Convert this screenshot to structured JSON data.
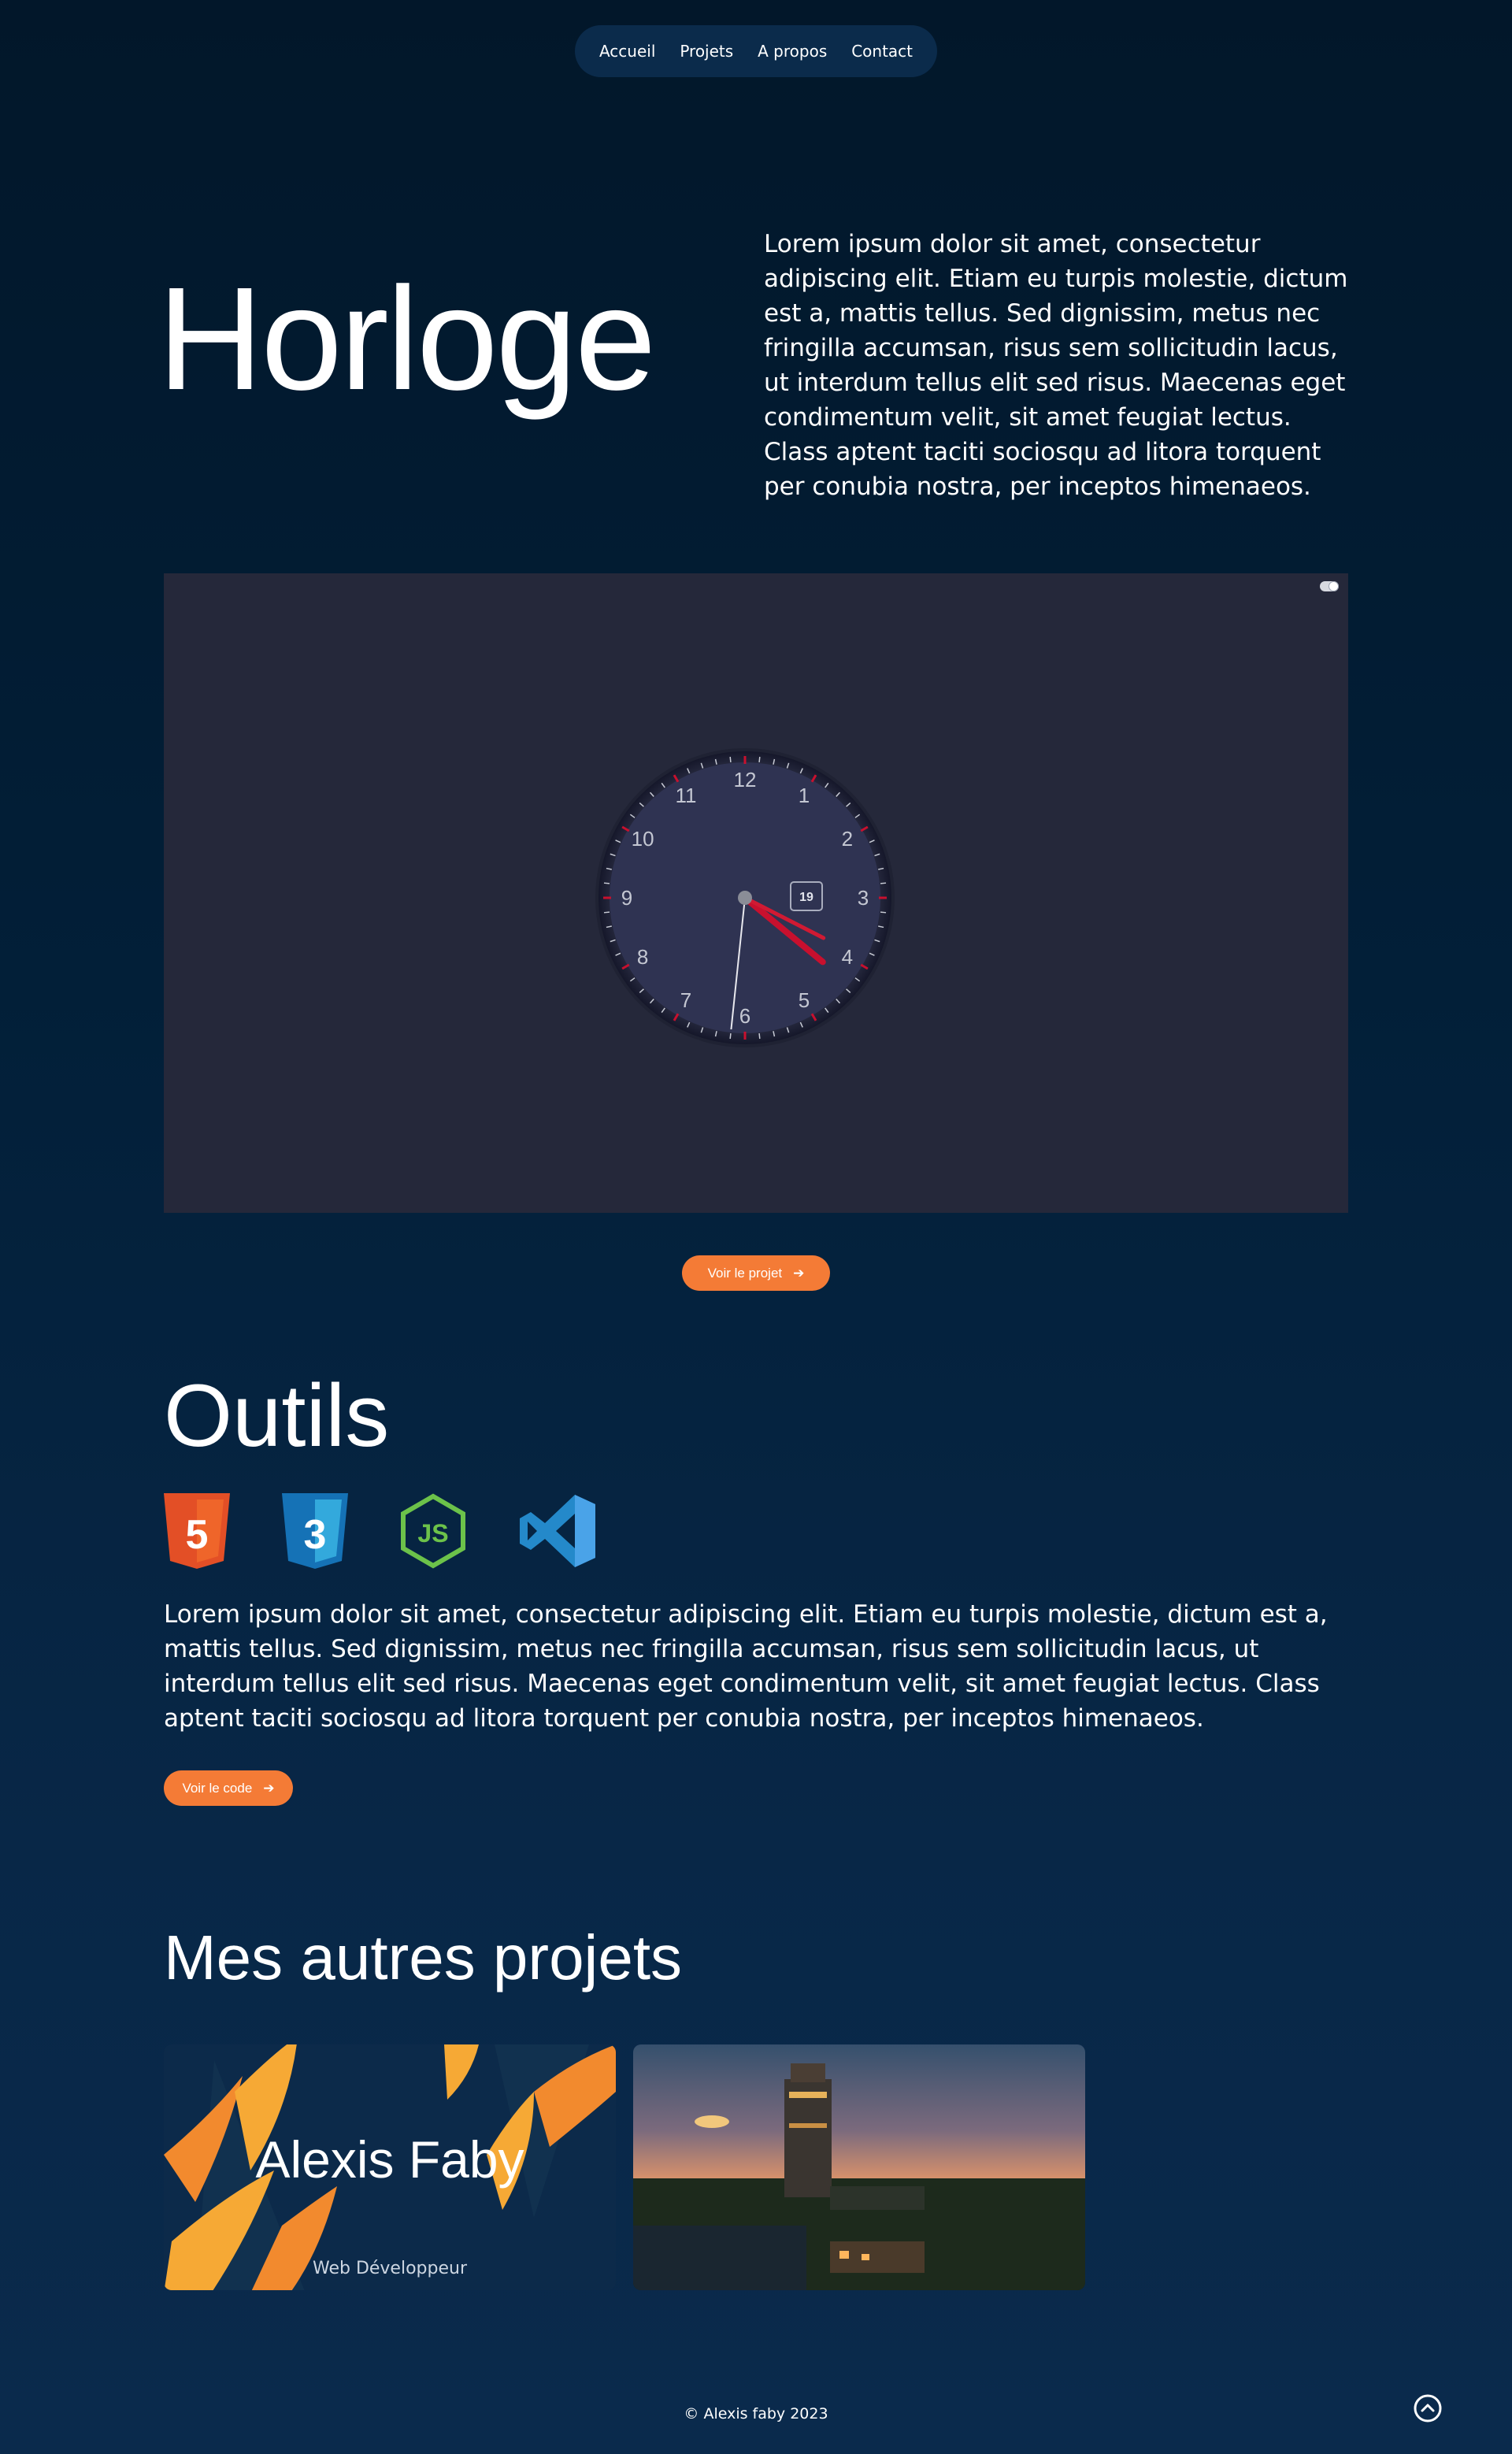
{
  "nav": {
    "items": [
      "Accueil",
      "Projets",
      "A propos",
      "Contact"
    ]
  },
  "hero": {
    "title": "Horloge",
    "description": "Lorem ipsum dolor sit amet, consectetur adipiscing elit. Etiam eu turpis molestie, dictum est a, mattis tellus. Sed dignissim, metus nec fringilla accumsan, risus sem sollicitudin lacus, ut interdum tellus elit sed risus. Maecenas eget condimentum velit, sit amet feugiat lectus. Class aptent taciti sociosqu ad litora torquent per conubia nostra, per inceptos himenaeos."
  },
  "clock": {
    "numbers": [
      "12",
      "1",
      "2",
      "3",
      "4",
      "5",
      "6",
      "7",
      "8",
      "9",
      "10",
      "11"
    ],
    "date": "19",
    "time": {
      "hours": 4,
      "minutes": 19,
      "seconds": 31
    }
  },
  "project_button": {
    "label": "Voir le projet",
    "icon": "arrow-right-icon"
  },
  "tools": {
    "title": "Outils",
    "icons": [
      "html5-icon",
      "css3-icon",
      "nodejs-icon",
      "vscode-icon"
    ],
    "html5_label": "5",
    "css3_label": "3",
    "nodejs_label": "JS",
    "description": "Lorem ipsum dolor sit amet, consectetur adipiscing elit. Etiam eu turpis molestie, dictum est a, mattis tellus. Sed dignissim, metus nec fringilla accumsan, risus sem sollicitudin lacus, ut interdum tellus elit sed risus. Maecenas eget condimentum velit, sit amet feugiat lectus. Class aptent taciti sociosqu ad litora torquent per conubia nostra, per inceptos himenaeos.",
    "button_label": "Voir le code"
  },
  "other_projects": {
    "title": "Mes autres projets",
    "cards": [
      {
        "title": "Alexis Faby",
        "subtitle": "Web Développeur"
      },
      {
        "title": "",
        "subtitle": ""
      }
    ]
  },
  "footer": {
    "copyright": "© Alexis faby 2023"
  },
  "colors": {
    "accent": "#f47b36",
    "clock_hand": "#c8102e",
    "preview_bg": "#25283a",
    "nav_bg": "#0b2b4b"
  }
}
